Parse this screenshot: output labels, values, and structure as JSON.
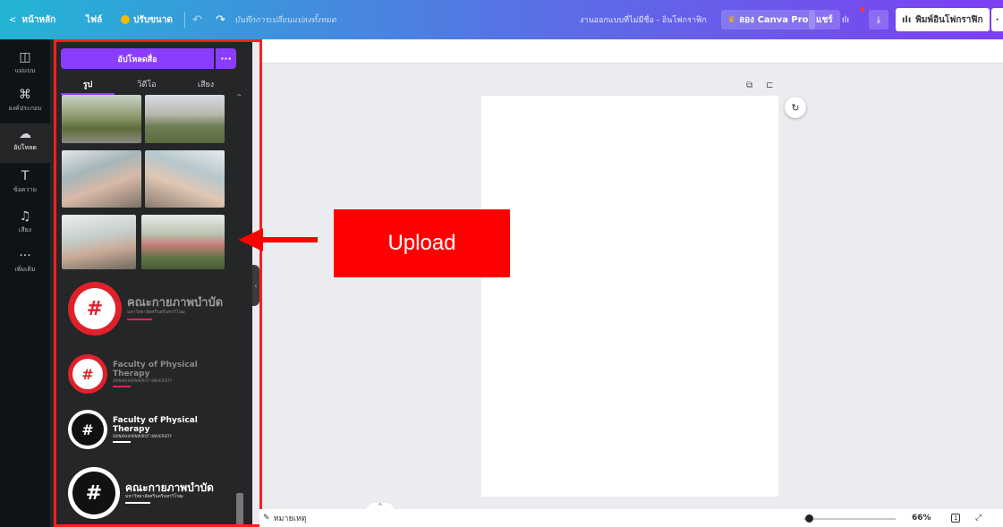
{
  "topbar": {
    "home_label": "หน้าหลัก",
    "file_label": "ไฟล์",
    "resize_label": "ปรับขนาด",
    "save_status": "บันทึกการเปลี่ยนแปลงทั้งหมด",
    "doc_title": "งานออกแบบที่ไม่มีชื่อ - อินโฟกราฟิก",
    "try_pro_label": "ลอง Canva Pro",
    "share_label": "แชร์",
    "print_label": "พิมพ์อินโฟกราฟิก",
    "more_label": "·"
  },
  "rail": [
    {
      "icon": "template-icon",
      "label": "แม่แบบ"
    },
    {
      "icon": "elements-icon",
      "label": "องค์ประกอบ"
    },
    {
      "icon": "upload-icon",
      "label": "อัปโหลด"
    },
    {
      "icon": "text-icon",
      "label": "ข้อความ"
    },
    {
      "icon": "audio-icon",
      "label": "เสียง"
    },
    {
      "icon": "more-icon",
      "label": "เพิ่มเติม"
    }
  ],
  "panel": {
    "upload_button": "อัปโหลดสื่อ",
    "more_button": "···",
    "tabs": [
      "รูป",
      "วิดีโอ",
      "เสียง"
    ],
    "logos": [
      {
        "title": "คณะกายภาพบำบัด",
        "subtitle": "มหาวิทยาลัยศรีนครินทรวิโรฒ"
      },
      {
        "title": "Faculty of Physical Therapy",
        "subtitle": "SRINAKHARINWIROT UNIVERSITY"
      },
      {
        "title": "Faculty of Physical Therapy",
        "subtitle": "SRINAKHARINWIROT UNIVERSITY"
      },
      {
        "title": "คณะกายภาพบำบัด",
        "subtitle": "มหาวิทยาลัยศรีนครินทรวิโรฒ"
      }
    ]
  },
  "annotation": {
    "callout_text": "Upload"
  },
  "bottombar": {
    "notes_label": "หมายเหตุ",
    "zoom": "66%",
    "page_num": "1"
  },
  "colors": {
    "accent": "#8b3dff",
    "highlight": "#ff0000"
  }
}
